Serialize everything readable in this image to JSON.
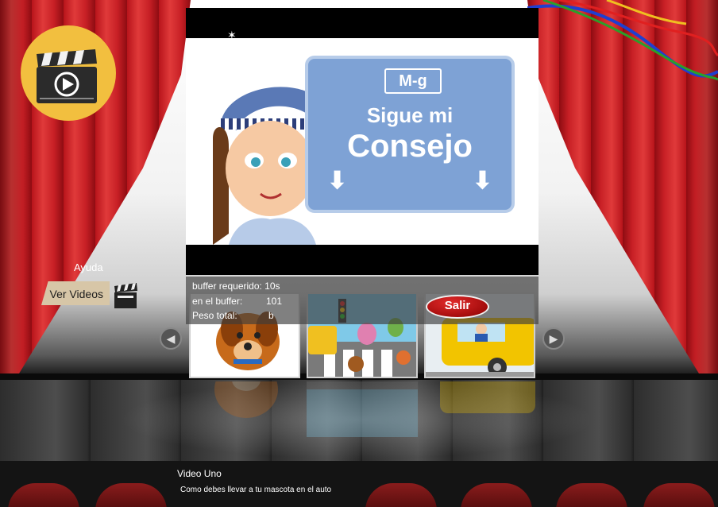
{
  "sidebar": {
    "help_label": "Ayuda",
    "videos_button_label": "Ver Videos"
  },
  "player": {
    "sign_badge": "M-g",
    "sign_line1": "Sigue mi",
    "sign_line2": "Consejo"
  },
  "buffer_info": {
    "required_label": "buffer requerido: 10s",
    "in_buffer_label": "en el buffer:",
    "in_buffer_value": "101",
    "total_weight_label": "Peso total:",
    "total_weight_value": "b"
  },
  "thumbnails": [
    {
      "name": "dog-thumbnail"
    },
    {
      "name": "crosswalk-thumbnail"
    },
    {
      "name": "school-bus-thumbnail"
    }
  ],
  "exit_label": "Salir",
  "caption": {
    "title": "Video Uno",
    "subtitle": "Como debes llevar a tu mascota en el auto"
  },
  "icons": {
    "logo": "clapperboard-play-icon",
    "prev": "chevron-left-icon",
    "next": "chevron-right-icon"
  },
  "colors": {
    "curtain": "#c71f25",
    "logo_bg": "#f2bf3f",
    "sign_bg": "#7ea2d5",
    "exit_button": "#c01515"
  }
}
